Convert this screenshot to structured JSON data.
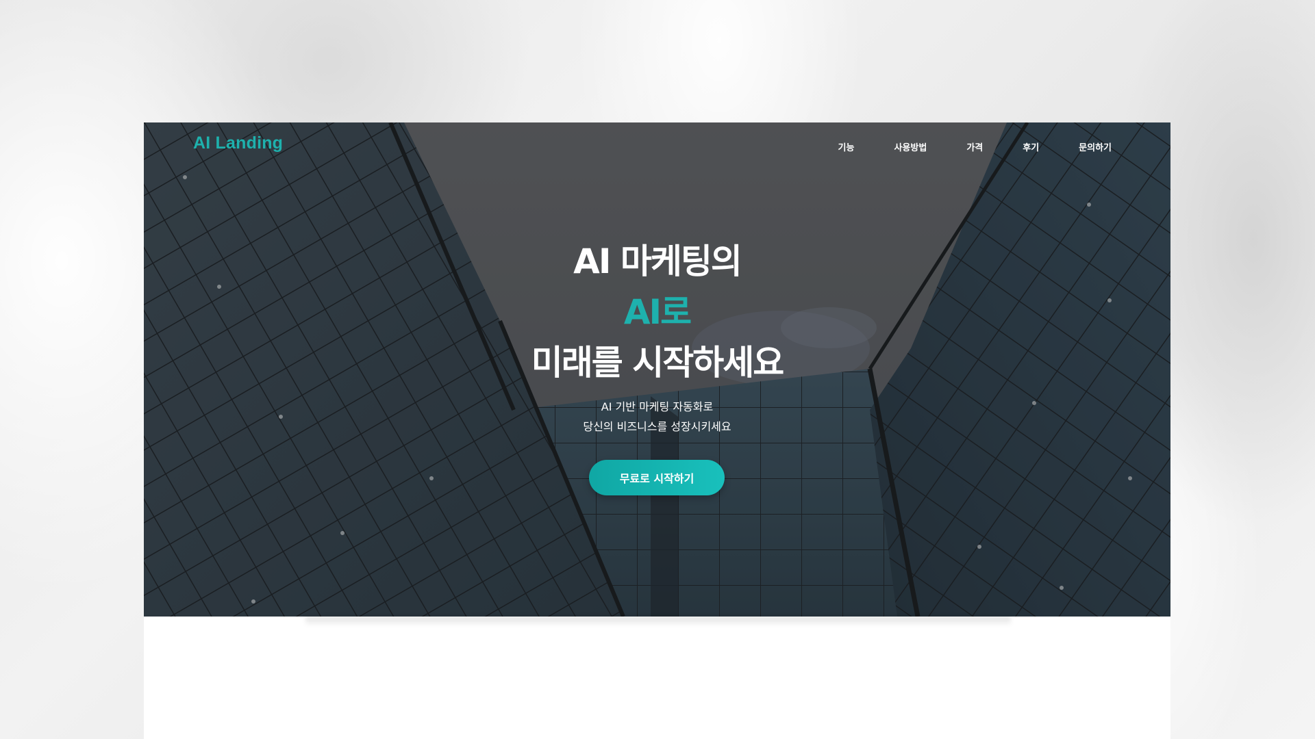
{
  "brand": {
    "logo": "AI Landing",
    "accent_color": "#1eb1ad"
  },
  "nav": {
    "items": [
      {
        "label": "기능"
      },
      {
        "label": "사용방법"
      },
      {
        "label": "가격"
      },
      {
        "label": "후기"
      },
      {
        "label": "문의하기"
      }
    ]
  },
  "hero": {
    "headline_line1": "AI 마케팅의",
    "headline_line2": "AI로",
    "headline_line3": "미래를 시작하세요",
    "subtext_line1": "AI 기반 마케팅 자동화로",
    "subtext_line2": "당신의 비즈니스를 성장시키세요",
    "cta_label": "무료로 시작하기",
    "background_image": "glass-office-buildings-photo"
  }
}
